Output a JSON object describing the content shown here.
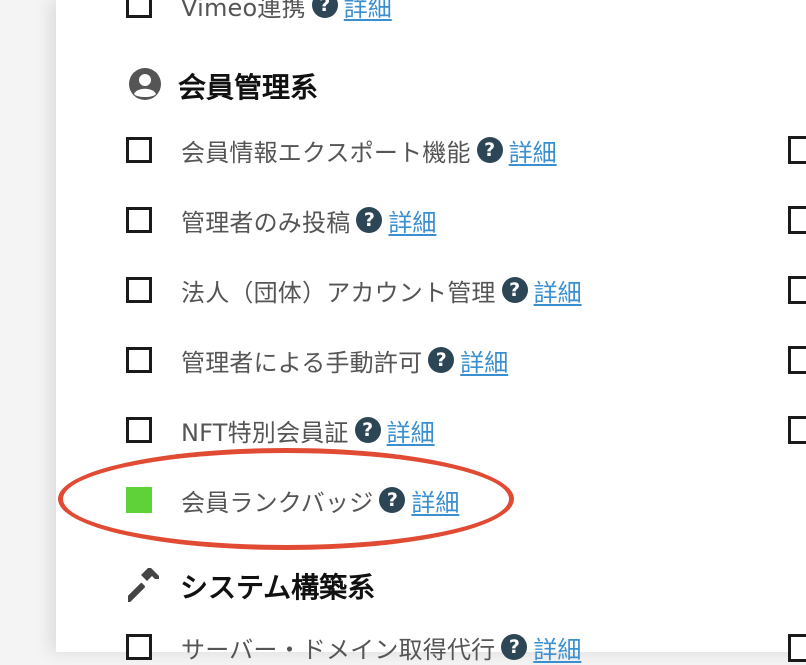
{
  "top_partial": {
    "label": "Vimeo連携",
    "link": "詳細"
  },
  "section_member": {
    "title": "会員管理系",
    "icon": "user-circle-icon"
  },
  "member_items": [
    {
      "label": "会員情報エクスポート機能",
      "link": "詳細",
      "checked": false
    },
    {
      "label": "管理者のみ投稿",
      "link": "詳細",
      "checked": false
    },
    {
      "label": "法人（団体）アカウント管理",
      "link": "詳細",
      "checked": false
    },
    {
      "label": "管理者による手動許可",
      "link": "詳細",
      "checked": false
    },
    {
      "label": "NFT特別会員証",
      "link": "詳細",
      "checked": false
    },
    {
      "label": "会員ランクバッジ",
      "link": "詳細",
      "checked": true
    }
  ],
  "section_system": {
    "title": "システム構築系",
    "icon": "hammer-icon"
  },
  "system_items": [
    {
      "label": "サーバー・ドメイン取得代行",
      "link": "詳細",
      "checked": false
    }
  ],
  "help_glyph": "?",
  "colors": {
    "checked": "#5fd23a",
    "link": "#3a8fd0",
    "help_bg": "#2d4656",
    "highlight": "#e14a33"
  }
}
